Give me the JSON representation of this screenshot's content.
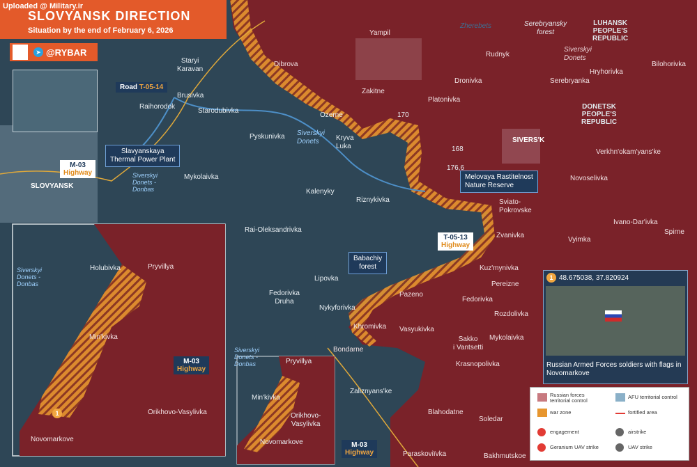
{
  "header": {
    "watermark": "Uploaded @ Military.ir",
    "title": "SLOVYANSK DIRECTION",
    "subtitle": "Situation by the end of February 6, 2026",
    "handle": "@RYBAR"
  },
  "colors": {
    "russian_control": "#7a2229",
    "afu_control": "#2e4656",
    "war_zone": "#e7962f",
    "accent": "#e35a2a",
    "engagement": "#e23b34"
  },
  "regions": {
    "luhansk": "LUHANSK\nPEOPLE'S\nREPUBLIC",
    "donetsk": "DONETSK\nPEOPLE'S\nREPUBLIC"
  },
  "settlements": {
    "yampil": "Yampil",
    "dibrova": "Dibrova",
    "staryi_karavan": "Staryi\nKaravan",
    "brusivka": "Brusivka",
    "raihorodok": "Raihorodok",
    "starodubivka": "Starodubivka",
    "pyskunivka": "Pyskunivka",
    "zakitne": "Zakitne",
    "ozerne": "Ozerne",
    "kryva_luka": "Kryva\nLuka",
    "platonivka": "Platonivka",
    "dronivka": "Dronivka",
    "rudnyk": "Rudnyk",
    "serebryanka": "Serebryanka",
    "hryhorivka": "Hryhorivka",
    "bilohorivka": "Bilohorivka",
    "siversk": "SIVERS'K",
    "verkhnokamyanske": "Verkhn'okam'yans'ke",
    "novoselivka": "Novoselivka",
    "ivano_darivka": "Ivano-Dar'ivka",
    "spirne": "Spirne",
    "vyimka": "Vyimka",
    "zvanivka": "Zvanivka",
    "sviato_pokrovske": "Sviato-\nPokrovske",
    "riznykivka": "Riznykivka",
    "kalenyky": "Kalenyky",
    "mykolaivka": "Mykolaivka",
    "sloviansk": "SLOVYANSK",
    "rai_oleksandrivka": "Rai-Oleksandrivka",
    "lipovka": "Lipovka",
    "fedorivka_druha": "Fedorivka\nDruha",
    "nykyforivka": "Nykyforivka",
    "khromivka": "Khromivka",
    "pazeno": "Pazeno",
    "vasyukivka": "Vasyukivka",
    "bondarne": "Bondarne",
    "kuzmynivka": "Kuz'mynivka",
    "pereizne": "Pereizne",
    "fedorivka": "Fedorivka",
    "rozdolivka": "Rozdolivka",
    "sakko": "Sakko\ni Vantsetti",
    "mykolaivka2": "Mykolaivka",
    "krasnopolivka": "Krasnopolivka",
    "zaliznyanske": "Zaliznyans'ke",
    "blahodatne": "Blahodatne",
    "soledar": "Soledar",
    "paraskoviivka": "Paraskoviïvka",
    "bakhmutskoe": "Bakhmutskoe",
    "pryvillya": "Pryvillya",
    "minkivka": "Min'kivka",
    "orikhovo": "Orikhovo-\nVasylivka",
    "novomarkove": "Novomarkove"
  },
  "rivers": {
    "zherebets": "Zherebets",
    "serebryansky_forest": "Serebryansky\nforest",
    "siverskyi_donets_1": "Siverskyi\nDonets",
    "siverskyi_donets_2": "Siverskyi\nDonets",
    "siverskyi_donets_3": "Siverskyi\nDonets",
    "siverskyi_donets_donbas": "Siverskyi\nDonets -\nDonbas",
    "siverskyi_donets_donbas_2": "Siverskyi\nDonets -\nDonbas",
    "siverskyi_donets_donbas_3": "Siverskyi\nDonets -\nDonbas"
  },
  "elevations": {
    "e170": "170",
    "e168": "168",
    "e176": "176,6"
  },
  "callouts": {
    "thermal_plant": "Slavyanskaya\nThermal Power Plant",
    "nature_reserve": "Melovaya Rastitelnost\nNature Reserve",
    "babachiy_forest": "Babachiy\nforest"
  },
  "roads": {
    "t0514_prefix": "Road ",
    "t0514": "T-05-14",
    "m03_a": "M-03",
    "m03_a_hw": "Highway",
    "t0513": "T-05-13",
    "t0513_hw": "Highway",
    "m03_b": "M-03",
    "m03_b_hw": "Highway",
    "m03_c": "M-03",
    "m03_c_hw": "Highway"
  },
  "inset": {
    "holubivka": "Holubivka",
    "pryvillya": "Pryvillya",
    "minkivka": "Min'kivka",
    "orikhovo": "Orikhovo-Vasylivka",
    "novomarkove": "Novomarkove",
    "badge": "1"
  },
  "photo": {
    "badge": "1",
    "coords": "48.675038, 37.820924",
    "caption": "Russian Armed Forces soldiers with flags in Novomarkove"
  },
  "legend": {
    "russian": "Russian forces\nterritorial control",
    "afu": "AFU territorial control",
    "war_zone": "war zone",
    "fortified": "fortified area",
    "engagement": "engagement",
    "airstrike": "airstrike",
    "geranium": "Geranium UAV strike",
    "uav": "UAV strike"
  }
}
